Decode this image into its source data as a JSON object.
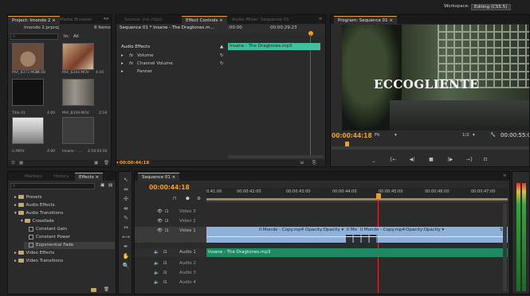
{
  "workspace": {
    "label": "Workspace:",
    "value": "Editing (CS5.5)"
  },
  "project": {
    "tabs": [
      "Project: Imondo 2 ×",
      "Media Browser"
    ],
    "file_name": "Imondo 2.prproj",
    "item_count": "8 Items",
    "search_in_label": "In:",
    "search_in_value": "All",
    "thumbs": [
      {
        "caption": "MVI_8373.MOV",
        "dur": "26:08"
      },
      {
        "caption": "MVI_8344.MOV",
        "dur": "4:10"
      },
      {
        "caption": "Title 01",
        "dur": "4:00"
      },
      {
        "caption": "MVI_8339.MOV",
        "dur": "2:18"
      },
      {
        "caption": "ic.MOV",
        "dur": "4:00"
      },
      {
        "caption": "Insane - ...",
        "dur": "2:16:03:02"
      }
    ]
  },
  "effect_controls": {
    "tabs": [
      "Source: (no clips)",
      "Effect Controls ×",
      "Audio Mixer: Sequence 01"
    ],
    "sequence_label": "Sequence 01 * Insane - The Dragtones.m...",
    "tc_start": ":00:00",
    "tc_end": "00:00:29:23",
    "clip_name": "Insane - The Dragtones.mp3",
    "section": "Audio Effects",
    "rows": [
      "Volume",
      "Channel Volume",
      "Panner"
    ],
    "fx_prefix": "fx",
    "timecode": "00:00:44:18"
  },
  "program": {
    "tab": "Program: Sequence 01 ×",
    "overlay_title": "ECCOGLIENTE",
    "timecode": "00:00:44:18",
    "fit": "Fit",
    "resolution": "1/2",
    "duration": "00:00:55:0",
    "buttons": [
      "⎵",
      "{←",
      "◀|",
      "■",
      "|▶",
      "→}",
      "⊡"
    ]
  },
  "effects_panel": {
    "tabs": [
      "Markers",
      "History",
      "Effects ×"
    ],
    "items": [
      {
        "label": "Presets",
        "indent": 0,
        "kind": "folder"
      },
      {
        "label": "Audio Effects",
        "indent": 0,
        "kind": "folder"
      },
      {
        "label": "Audio Transitions",
        "indent": 0,
        "kind": "folder"
      },
      {
        "label": "Crossfade",
        "indent": 1,
        "kind": "folder"
      },
      {
        "label": "Constant Gain",
        "indent": 2,
        "kind": "fx"
      },
      {
        "label": "Constant Power",
        "indent": 2,
        "kind": "fx"
      },
      {
        "label": "Exponential Fade",
        "indent": 2,
        "kind": "fx"
      },
      {
        "label": "Video Effects",
        "indent": 0,
        "kind": "folder"
      },
      {
        "label": "Video Transitions",
        "indent": 0,
        "kind": "folder"
      }
    ]
  },
  "tools": [
    "↖",
    "⇹",
    "✣",
    "⇼",
    "✎",
    "↔",
    "⟷",
    "✒",
    "✋",
    "🔍"
  ],
  "timeline": {
    "tab": "Sequence 01 ×",
    "timecode": "00:00:44:18",
    "ruler": [
      "0:41:00",
      "00:00:42:00",
      "00:00:43:00",
      "00:00:44:00",
      "00:00:45:00",
      "00:00:46:00",
      "00:00:47:00"
    ],
    "video_tracks": [
      "Video 3",
      "Video 2",
      "Video 1"
    ],
    "audio_tracks": [
      "Audio 1",
      "Audio 2",
      "Audio 3",
      "Audio 4"
    ],
    "clips_v1": [
      "Il Mondo - Copy.mp4",
      "Opacity:Opacity ▾",
      "Il Mo",
      "Il Mondo - Copy.mp4",
      "Opacity:Opacity ▾",
      "Sl"
    ],
    "clip_a1": "Insane - The Dragtones.mp3"
  },
  "colors": {
    "accent": "#f0a020",
    "video_clip": "#8fb0d8",
    "audio_clip": "#1e8a63",
    "playhead": "#e03030"
  }
}
